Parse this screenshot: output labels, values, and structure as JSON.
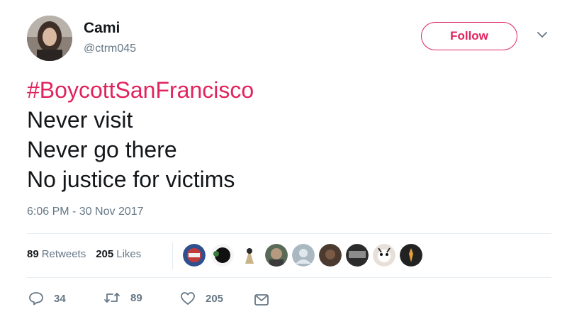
{
  "user": {
    "display_name": "Cami",
    "handle": "@ctrm045"
  },
  "follow_label": "Follow",
  "tweet": {
    "hashtag": "#BoycottSanFrancisco",
    "lines": [
      "Never visit",
      "Never go there",
      "No justice for victims"
    ]
  },
  "timestamp": "6:06 PM - 30 Nov 2017",
  "stats": {
    "retweets_count": "89",
    "retweets_label": "Retweets",
    "likes_count": "205",
    "likes_label": "Likes"
  },
  "actions": {
    "reply_count": "34",
    "retweet_count": "89",
    "like_count": "205"
  },
  "icons": {
    "reply": "reply-icon",
    "retweet": "retweet-icon",
    "like": "heart-icon",
    "message": "envelope-icon",
    "caret": "chevron-down-icon"
  },
  "colors": {
    "accent": "#e0245e",
    "text": "#14171a",
    "secondary": "#657786",
    "divider": "#e6ecf0"
  }
}
